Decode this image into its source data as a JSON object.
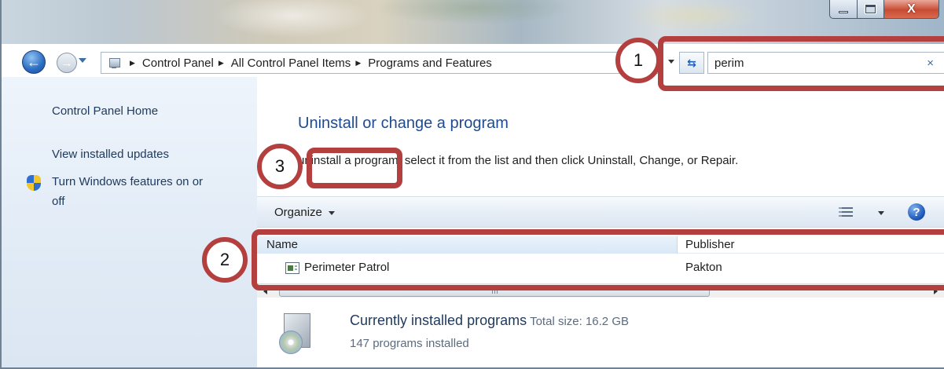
{
  "window": {
    "controls": {
      "close_glyph": "X"
    }
  },
  "nav": {
    "back_icon": "back-arrow-icon",
    "forward_icon": "forward-arrow-icon",
    "breadcrumbs": [
      "Control Panel",
      "All Control Panel Items",
      "Programs and Features"
    ],
    "search": {
      "value": "perim",
      "clear_glyph": "×"
    }
  },
  "sidebar": {
    "items": [
      {
        "label": "Control Panel Home"
      },
      {
        "label": "View installed updates"
      },
      {
        "label": "Turn Windows features on or",
        "label_line2": "off",
        "icon": "windows-shield-icon"
      }
    ]
  },
  "main": {
    "title": "Uninstall or change a program",
    "instructions": "uninstall a program, select it from the list and then click Uninstall, Change, or Repair.",
    "toolbar": {
      "organize_label": "Organize",
      "help_glyph": "?"
    },
    "columns": {
      "name": "Name",
      "publisher": "Publisher"
    },
    "rows": [
      {
        "name": "Perimeter Patrol",
        "publisher": "Pakton"
      }
    ],
    "scrollbar": {
      "grip": "III"
    },
    "footer": {
      "title": "Currently installed programs",
      "total_size_label": "Total size: 16.2 GB",
      "count_label": "147 programs installed"
    }
  },
  "annotations": [
    {
      "number": "1",
      "target": "search box"
    },
    {
      "number": "2",
      "target": "program list"
    },
    {
      "number": "3",
      "target": "instructions"
    }
  ],
  "colors": {
    "annotation": "#b3403f",
    "title_blue": "#1e4b8f",
    "link_blue": "#1e395b",
    "sidebar_bg": "#e1ebf6"
  }
}
